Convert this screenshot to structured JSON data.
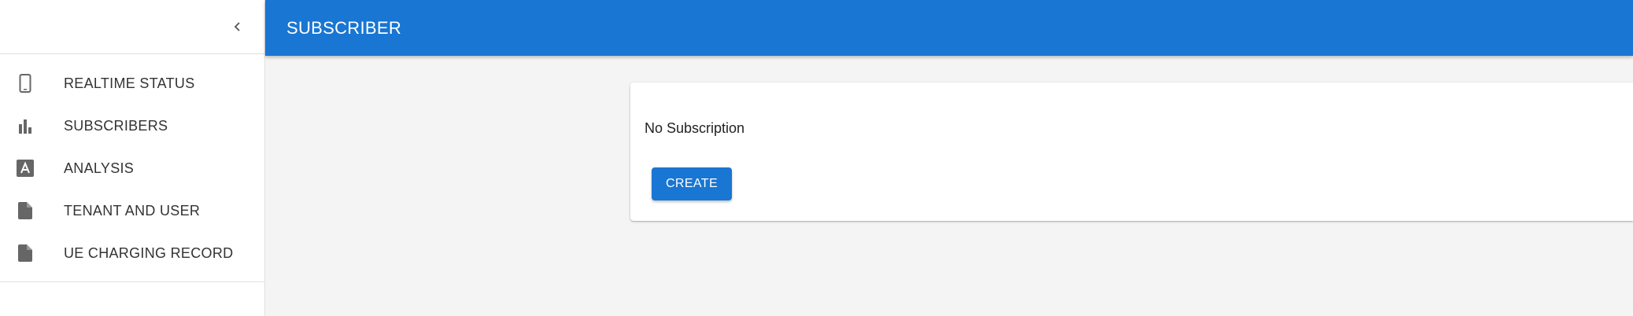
{
  "sidebar": {
    "collapse_icon": "chevron-left-icon",
    "items": [
      {
        "label": "REALTIME STATUS",
        "icon": "smartphone-icon"
      },
      {
        "label": "SUBSCRIBERS",
        "icon": "bar-chart-icon"
      },
      {
        "label": "ANALYSIS",
        "icon": "text-box-a-icon"
      },
      {
        "label": "TENANT AND USER",
        "icon": "file-icon"
      },
      {
        "label": "UE CHARGING RECORD",
        "icon": "file-icon"
      }
    ]
  },
  "appbar": {
    "title": "SUBSCRIBER",
    "color": "#1976d2"
  },
  "main": {
    "message": "No Subscription",
    "create_label": "CREATE"
  }
}
